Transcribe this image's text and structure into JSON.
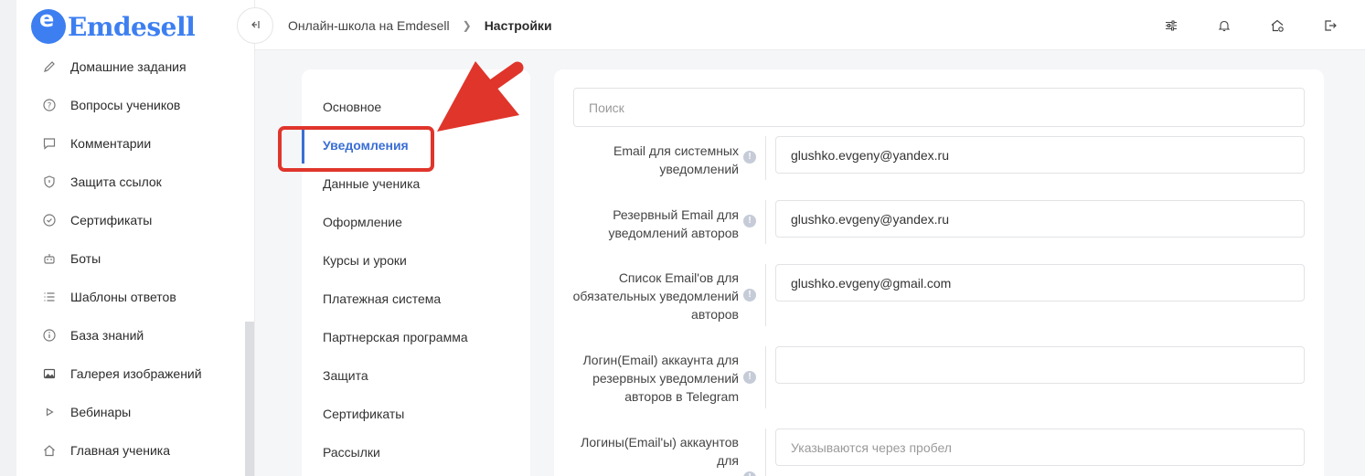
{
  "brand": {
    "logo_letter": "e",
    "name": "Emdesell",
    "color": "#3d7ff1"
  },
  "sidebar": {
    "items": [
      {
        "label": "Домашние задания",
        "icon": "pencil-icon"
      },
      {
        "label": "Вопросы учеников",
        "icon": "question-circle-icon"
      },
      {
        "label": "Комментарии",
        "icon": "comment-icon"
      },
      {
        "label": "Защита ссылок",
        "icon": "shield-icon"
      },
      {
        "label": "Сертификаты",
        "icon": "check-circle-icon"
      },
      {
        "label": "Боты",
        "icon": "robot-icon"
      },
      {
        "label": "Шаблоны ответов",
        "icon": "list-icon"
      },
      {
        "label": "База знаний",
        "icon": "info-circle-icon"
      },
      {
        "label": "Галерея изображений",
        "icon": "image-icon"
      },
      {
        "label": "Вебинары",
        "icon": "play-icon"
      },
      {
        "label": "Главная ученика",
        "icon": "home-icon"
      }
    ]
  },
  "header": {
    "collapse_icon": "collapse-sidebar-icon",
    "breadcrumb": [
      "Онлайн-школа на Emdesell",
      "Настройки"
    ],
    "tools": [
      "sliders-icon",
      "bell-icon",
      "home-settings-icon",
      "logout-icon"
    ]
  },
  "settings_menu": {
    "items": [
      "Основное",
      "Уведомления",
      "Данные ученика",
      "Оформление",
      "Курсы и уроки",
      "Платежная система",
      "Партнерская программа",
      "Защита",
      "Сертификаты",
      "Рассылки"
    ],
    "active": "Уведомления",
    "accent": "#3b6fd4"
  },
  "annotation": {
    "color": "#e0352b"
  },
  "form": {
    "search_placeholder": "Поиск",
    "rows": [
      {
        "label": "Email для системных уведомлений",
        "value": "glushko.evgeny@yandex.ru",
        "placeholder": ""
      },
      {
        "label": "Резервный Email для уведомлений авторов",
        "value": "glushko.evgeny@yandex.ru",
        "placeholder": ""
      },
      {
        "label": "Список Email'ов для обязательных уведомлений авторов",
        "value": "glushko.evgeny@gmail.com",
        "placeholder": ""
      },
      {
        "label": "Логин(Email) аккаунта для резервных уведомлений авторов в Telegram",
        "value": "",
        "placeholder": ""
      },
      {
        "label": "Логины(Email'ы) аккаунтов для",
        "value": "",
        "placeholder": "Указываются через пробел"
      }
    ]
  }
}
